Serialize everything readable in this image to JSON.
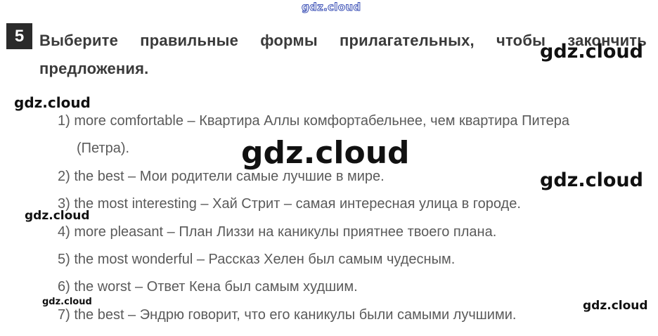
{
  "watermark": {
    "text": "gdz.cloud"
  },
  "task": {
    "number": "5",
    "instruction_line1": "Выберите правильные формы прилагательных, чтобы закончить",
    "instruction_line2": "предложения."
  },
  "answers": [
    {
      "text": "1) more comfortable – Квартира Аллы комфортабельнее, чем квартира Питера"
    },
    {
      "text": "(Петра)."
    },
    {
      "text": "2) the best – Мои родители самые лучшие в мире."
    },
    {
      "text": "3) the most interesting – Хай Стрит – самая интересная улица в городе."
    },
    {
      "text": "4) more pleasant – План Лиззи на каникулы приятнее твоего плана."
    },
    {
      "text": "5) the most wonderful – Рассказ Хелен был самым чудесным."
    },
    {
      "text": "6) the worst – Ответ Кена был самым худшим."
    },
    {
      "text": "7) the best – Эндрю говорит, что его каникулы были самыми лучшими."
    }
  ]
}
